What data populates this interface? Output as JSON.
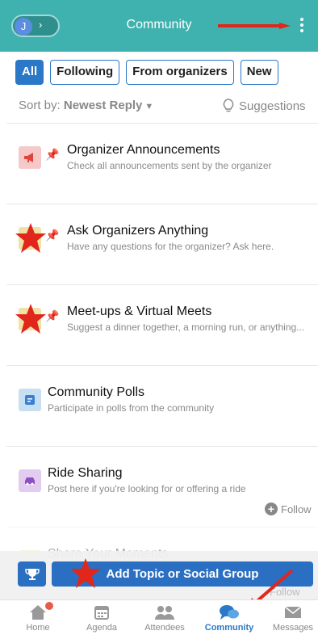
{
  "header": {
    "avatar_initial": "J",
    "title": "Community"
  },
  "filters": [
    {
      "label": "All",
      "active": true
    },
    {
      "label": "Following",
      "active": false
    },
    {
      "label": "From organizers",
      "active": false
    },
    {
      "label": "New",
      "active": false
    }
  ],
  "sort": {
    "prefix": "Sort by:",
    "value": "Newest Reply",
    "suggestions_label": "Suggestions"
  },
  "topics": [
    {
      "title": "Organizer Announcements",
      "subtitle": "Check all announcements sent by the organizer",
      "icon": "megaphone-icon",
      "color": "#f6c9c9",
      "pinned": true
    },
    {
      "title": "Ask Organizers Anything",
      "subtitle": "Have any questions for the organizer? Ask here.",
      "icon": "question-icon",
      "color": "#f0e2a4",
      "pinned": true
    },
    {
      "title": "Meet-ups & Virtual Meets",
      "subtitle": "Suggest a dinner together, a morning run, or anything...",
      "icon": "meetup-icon",
      "color": "#f0e2a4",
      "pinned": true
    },
    {
      "title": "Community Polls",
      "subtitle": "Participate in polls from the community",
      "icon": "poll-icon",
      "color": "#c7def3",
      "pinned": false
    },
    {
      "title": "Ride Sharing",
      "subtitle": "Post here if you're looking for or offering a ride",
      "icon": "car-icon",
      "color": "#e2cdf0",
      "pinned": false,
      "follow_label": "Follow"
    },
    {
      "title": "Share Your Moments",
      "subtitle": "",
      "icon": "photo-icon",
      "color": "#f0e2a4",
      "pinned": false
    }
  ],
  "add_bar": {
    "button_label": "Add Topic or Social Group",
    "ghost_follow": "Follow"
  },
  "nav": [
    {
      "label": "Home",
      "icon": "home-icon",
      "active": false
    },
    {
      "label": "Agenda",
      "icon": "calendar-icon",
      "active": false
    },
    {
      "label": "Attendees",
      "icon": "people-icon",
      "active": false
    },
    {
      "label": "Community",
      "icon": "chat-icon",
      "active": true
    },
    {
      "label": "Messages",
      "icon": "envelope-icon",
      "active": false
    }
  ],
  "colors": {
    "header": "#3fb1ae",
    "accent": "#2a78c7",
    "button": "#2a6fc2",
    "annotation_red": "#e1261c"
  }
}
